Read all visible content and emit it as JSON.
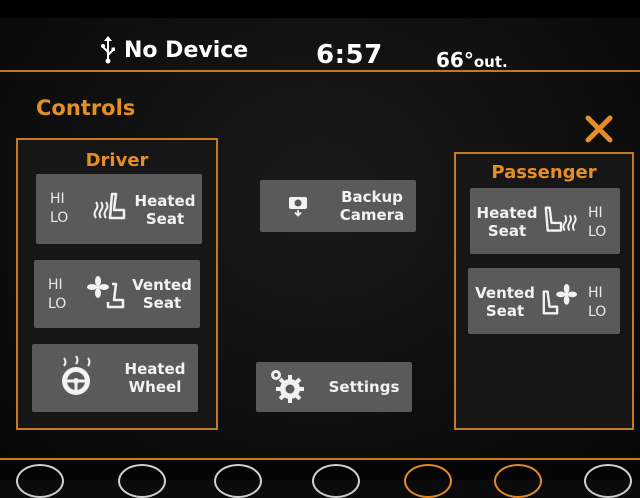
{
  "status": {
    "usb_status": "No Device",
    "time": "6:57",
    "temperature": "66°",
    "temperature_suffix": "out."
  },
  "page": {
    "title": "Controls"
  },
  "driver": {
    "title": "Driver",
    "heated_seat": {
      "hi": "HI",
      "lo": "LO",
      "label_line1": "Heated",
      "label_line2": "Seat"
    },
    "vented_seat": {
      "hi": "HI",
      "lo": "LO",
      "label_line1": "Vented",
      "label_line2": "Seat"
    },
    "heated_wheel": {
      "label_line1": "Heated",
      "label_line2": "Wheel"
    }
  },
  "center": {
    "backup_camera": {
      "label_line1": "Backup",
      "label_line2": "Camera"
    },
    "settings": {
      "label": "Settings"
    }
  },
  "passenger": {
    "title": "Passenger",
    "heated_seat": {
      "hi": "HI",
      "lo": "LO",
      "label_line1": "Heated",
      "label_line2": "Seat"
    },
    "vented_seat": {
      "hi": "HI",
      "lo": "LO",
      "label_line1": "Vented",
      "label_line2": "Seat"
    }
  },
  "colors": {
    "accent": "#e58e24",
    "border": "#c7791e",
    "button": "#5a5a5a"
  },
  "icons": [
    "usb-icon",
    "close-icon",
    "heated-seat-icon",
    "vented-seat-icon",
    "heated-wheel-icon",
    "camera-icon",
    "gear-icon"
  ]
}
